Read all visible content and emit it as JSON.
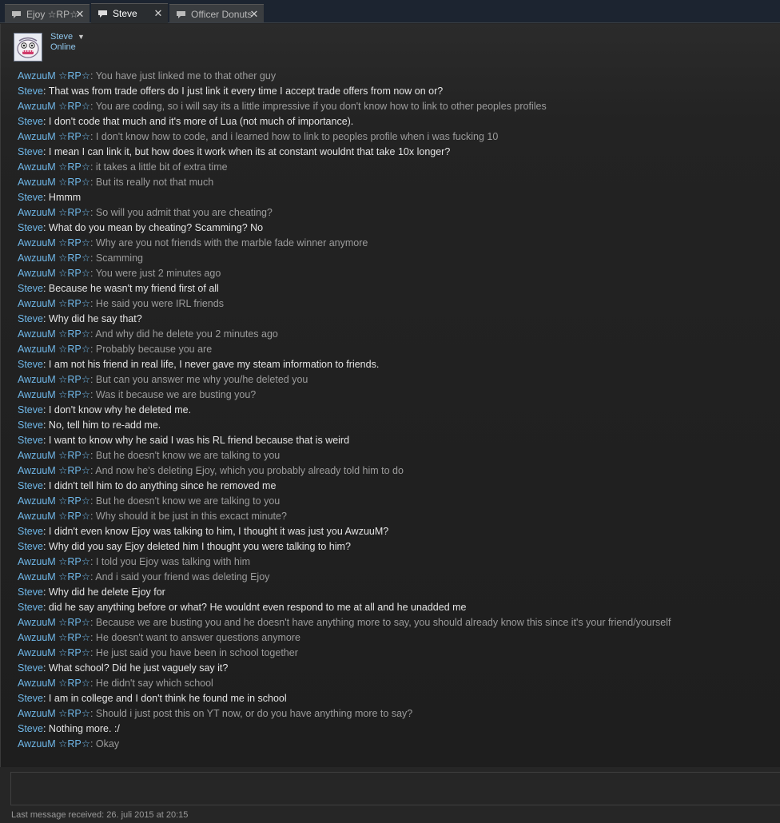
{
  "tabs": [
    {
      "label": "Ejoy ☆RP☆",
      "close": "✕",
      "active": false
    },
    {
      "label": "Steve",
      "close": "✕",
      "active": true
    },
    {
      "label": "Officer Donuts",
      "close": "✕",
      "active": false
    }
  ],
  "contact": {
    "name": "Steve",
    "dropdown": "▼",
    "status": "Online"
  },
  "colors": {
    "sender": "#6fb7e8",
    "steve_text": "#e4e4e4",
    "other_text": "#9c9c9c"
  },
  "messages": [
    {
      "sender": "AwzuuM ☆RP☆",
      "text": "You have just linked me to that other guy"
    },
    {
      "sender": "Steve",
      "text": "That was from trade offers do I just link it every time I accept trade offers from now on or?"
    },
    {
      "sender": "AwzuuM ☆RP☆",
      "text": "You are coding, so i will say its a little impressive if you don't know how to link to other peoples profiles"
    },
    {
      "sender": "Steve",
      "text": "I don't code that much and it's more of Lua (not much of importance)."
    },
    {
      "sender": "AwzuuM ☆RP☆",
      "text": "I don't know how to code, and i learned how to link to peoples profile when i was fucking 10"
    },
    {
      "sender": "Steve",
      "text": "I mean I can link it, but how does it work when its at constant wouldnt that take 10x longer?"
    },
    {
      "sender": "AwzuuM ☆RP☆",
      "text": "it takes a little bit of extra time"
    },
    {
      "sender": "AwzuuM ☆RP☆",
      "text": "But its really not that much"
    },
    {
      "sender": "Steve",
      "text": "Hmmm"
    },
    {
      "sender": "AwzuuM ☆RP☆",
      "text": "So will you admit that you are cheating?"
    },
    {
      "sender": "Steve",
      "text": "What do you mean by cheating? Scamming? No"
    },
    {
      "sender": "AwzuuM ☆RP☆",
      "text": "Why are you not friends with the marble fade winner anymore"
    },
    {
      "sender": "AwzuuM ☆RP☆",
      "text": "Scamming"
    },
    {
      "sender": "AwzuuM ☆RP☆",
      "text": "You were just 2 minutes ago"
    },
    {
      "sender": "Steve",
      "text": "Because he wasn't my friend first of all"
    },
    {
      "sender": "AwzuuM ☆RP☆",
      "text": "He said you were IRL friends"
    },
    {
      "sender": "Steve",
      "text": "Why did he say that?"
    },
    {
      "sender": "AwzuuM ☆RP☆",
      "text": "And why did he delete you 2 minutes ago"
    },
    {
      "sender": "AwzuuM ☆RP☆",
      "text": "Probably because you are"
    },
    {
      "sender": "Steve",
      "text": "I am not his friend in real life, I never gave my steam information to friends."
    },
    {
      "sender": "AwzuuM ☆RP☆",
      "text": "But can you answer me why you/he deleted you"
    },
    {
      "sender": "AwzuuM ☆RP☆",
      "text": "Was it because we are busting you?"
    },
    {
      "sender": "Steve",
      "text": "I don't know why he deleted me."
    },
    {
      "sender": "Steve",
      "text": "No, tell him to re-add me."
    },
    {
      "sender": "Steve",
      "text": "I want to know why he said I was his RL friend because that is weird"
    },
    {
      "sender": "AwzuuM ☆RP☆",
      "text": "But he doesn't know we are talking to you"
    },
    {
      "sender": "AwzuuM ☆RP☆",
      "text": "And now he's deleting Ejoy, which you probably already told him to do"
    },
    {
      "sender": "Steve",
      "text": "I didn't tell him to do anything since he removed me"
    },
    {
      "sender": "AwzuuM ☆RP☆",
      "text": "But he doesn't know we are talking to you"
    },
    {
      "sender": "AwzuuM ☆RP☆",
      "text": "Why should it be just in this excact minute?"
    },
    {
      "sender": "Steve",
      "text": "I didn't even know Ejoy was talking to him, I thought it was just you AwzuuM?"
    },
    {
      "sender": "Steve",
      "text": "Why did you say Ejoy deleted him I thought you were talking to him?"
    },
    {
      "sender": "AwzuuM ☆RP☆",
      "text": "I told you Ejoy was talking with him"
    },
    {
      "sender": "AwzuuM ☆RP☆",
      "text": "And i said your friend was deleting Ejoy"
    },
    {
      "sender": "Steve",
      "text": "Why did he delete Ejoy for"
    },
    {
      "sender": "Steve",
      "text": "did he say anything before or what? He wouldnt even respond to me at all and he unadded me"
    },
    {
      "sender": "AwzuuM ☆RP☆",
      "text": "Because we are busting you and he doesn't have anything more to say, you should already know this since it's your friend/yourself"
    },
    {
      "sender": "AwzuuM ☆RP☆",
      "text": "He doesn't want to answer questions anymore"
    },
    {
      "sender": "AwzuuM ☆RP☆",
      "text": "He just said you have been in school together"
    },
    {
      "sender": "Steve",
      "text": "What school? Did he just vaguely say it?"
    },
    {
      "sender": "AwzuuM ☆RP☆",
      "text": "He didn't say which school"
    },
    {
      "sender": "Steve",
      "text": "I am in college and I don't think he found me in school"
    },
    {
      "sender": "AwzuuM ☆RP☆",
      "text": "Should i just post this on YT now, or do you have anything more to say?"
    },
    {
      "sender": "Steve",
      "text": "Nothing more. :/"
    },
    {
      "sender": "AwzuuM ☆RP☆",
      "text": "Okay"
    }
  ],
  "input": {
    "value": "",
    "placeholder": ""
  },
  "status": {
    "last_message": "Last message received: 26. juli 2015 at 20:15"
  }
}
